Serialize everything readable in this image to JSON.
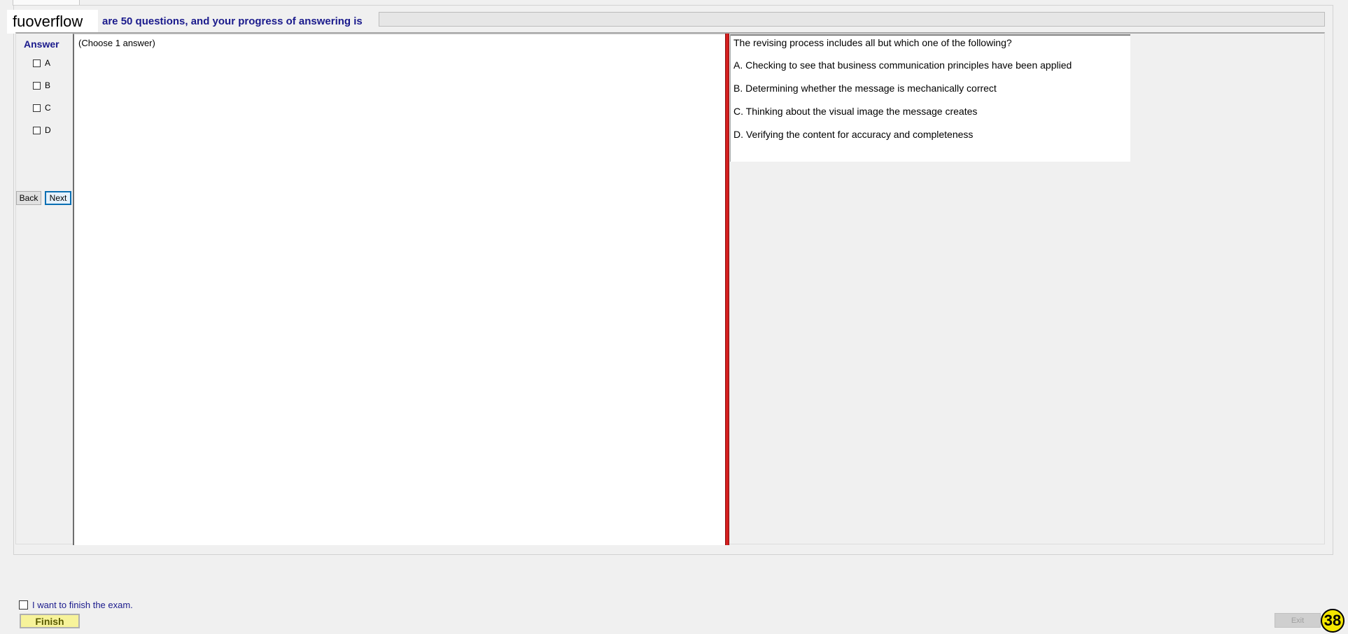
{
  "watermark": "fuoverflow",
  "header": {
    "progress_text": "are 50 questions, and your progress of answering is",
    "progress": 0
  },
  "answer_panel": {
    "heading": "Answer",
    "options": [
      "A",
      "B",
      "C",
      "D"
    ],
    "back_label": "Back",
    "next_label": "Next"
  },
  "left_pane": {
    "hint": "(Choose 1 answer)"
  },
  "question": {
    "text": "The revising process includes all but which one of the following?",
    "options": [
      "A.  Checking to see that business communication principles have been applied",
      "B.  Determining whether the message is mechanically correct",
      "C.  Thinking about the visual image the message creates",
      "D.  Verifying the content for accuracy and completeness"
    ]
  },
  "footer": {
    "finish_checkbox_label": "I want to finish the exam.",
    "finish_label": "Finish",
    "exit_label": "Exit",
    "badge": "38"
  },
  "colors": {
    "accent_blue": "#1a1a8c",
    "splitter_red": "#d41f1f",
    "finish_yellow": "#f7f39a",
    "badge_yellow": "#f4e600"
  }
}
